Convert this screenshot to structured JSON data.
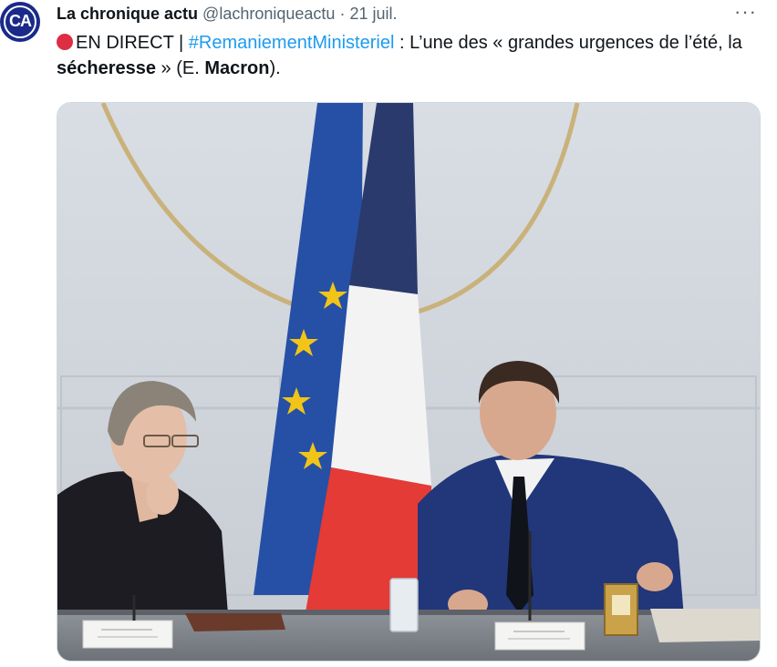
{
  "tweet": {
    "author_name": "La chronique actu",
    "handle": "@lachroniqueactu",
    "separator": "·",
    "date": "21 juil.",
    "more": "···",
    "avatar_text": "CA",
    "text": {
      "prefix": "EN DIRECT |",
      "hashtag": "#RemaniementMinisteriel",
      "part1": " : L’une des « grandes urgences de l’été, la ",
      "bold1": "sécheresse",
      "part2": " » (E. ",
      "bold2": "Macron",
      "part3": ")."
    }
  },
  "colors": {
    "link": "#1d9bf0",
    "secondary_text": "#536471",
    "live_dot": "#dd2e44"
  }
}
